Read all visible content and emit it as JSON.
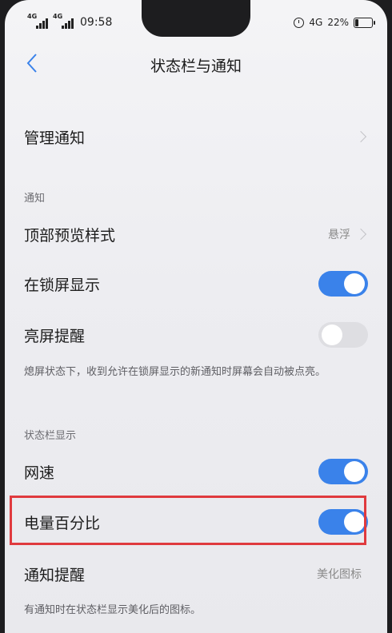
{
  "status_bar": {
    "sim1": "4G",
    "sim2": "4G",
    "time": "09:58",
    "network": "4G",
    "battery": "22%",
    "battery_level": 0.22
  },
  "header": {
    "title": "状态栏与通知"
  },
  "rows": {
    "manage": {
      "label": "管理通知"
    },
    "notify_section": "通知",
    "preview": {
      "label": "顶部预览样式",
      "value": "悬浮"
    },
    "lockscreen": {
      "label": "在锁屏显示",
      "on": true
    },
    "wake": {
      "label": "亮屏提醒",
      "on": false
    },
    "wake_desc": "熄屏状态下，收到允许在锁屏显示的新通知时屏幕会自动被点亮。",
    "statusbar_section": "状态栏显示",
    "speed": {
      "label": "网速",
      "on": true
    },
    "percent": {
      "label": "电量百分比",
      "on": true
    },
    "reminder": {
      "label": "通知提醒",
      "value": "美化图标"
    },
    "reminder_desc": "有通知时在状态栏显示美化后的图标。"
  },
  "colors": {
    "accent": "#3a82ea",
    "highlight": "#e03a3e"
  }
}
